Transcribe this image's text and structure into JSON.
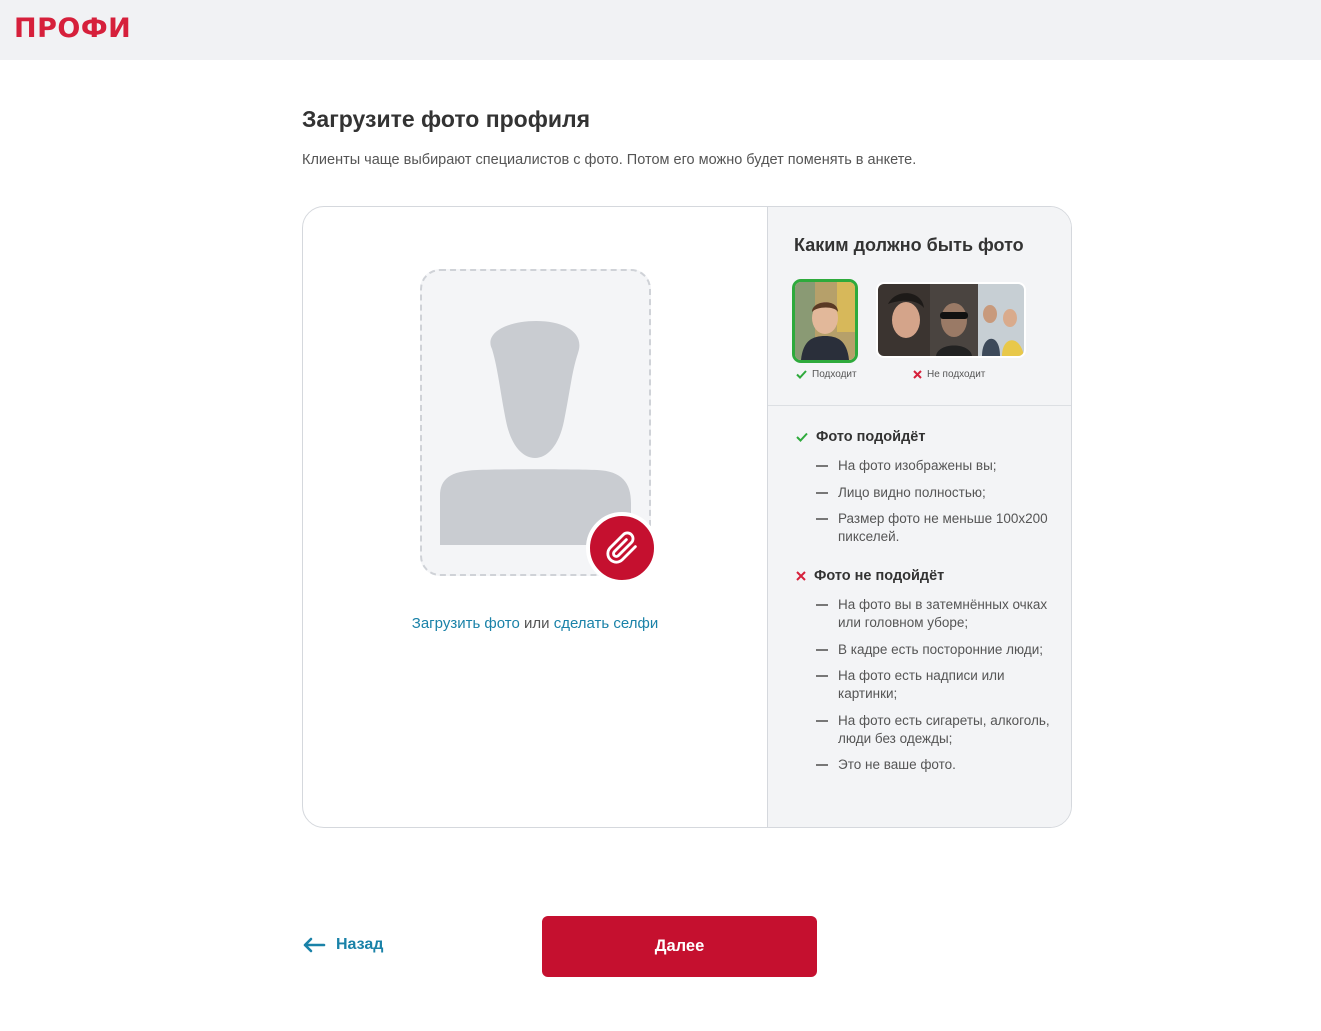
{
  "header": {
    "logo_text": "ПРОФИ",
    "logo_color": "#d6203b"
  },
  "page": {
    "title": "Загрузите фото профиля",
    "subtitle": "Клиенты чаще выбирают специалистов с фото. Потом его можно будет поменять в анкете."
  },
  "upload": {
    "upload_link": "Загрузить фото",
    "or_text": " или ",
    "selfie_link": "сделать селфи",
    "icon": "paperclip-icon"
  },
  "guide": {
    "title": "Каким должно быть фото",
    "good_caption": "Подходит",
    "bad_caption": "Не подходит",
    "good_head": "Фото подойдёт",
    "good_items": [
      "На фото изображены вы;",
      "Лицо видно полностью;",
      "Размер фото не меньше 100х200 пикселей."
    ],
    "bad_head": "Фото не подойдёт",
    "bad_items": [
      "На фото вы в затемнённых очках или головном уборе;",
      "В кадре есть посторонние люди;",
      "На фото есть надписи или картинки;",
      "На фото есть сигареты, алкоголь, люди без одежды;",
      "Это не ваше фото."
    ]
  },
  "footer": {
    "back_label": "Назад",
    "next_label": "Далее"
  },
  "colors": {
    "accent": "#c5102f",
    "link": "#1a82a8",
    "ok": "#2eaa3c",
    "error": "#d6203b"
  }
}
